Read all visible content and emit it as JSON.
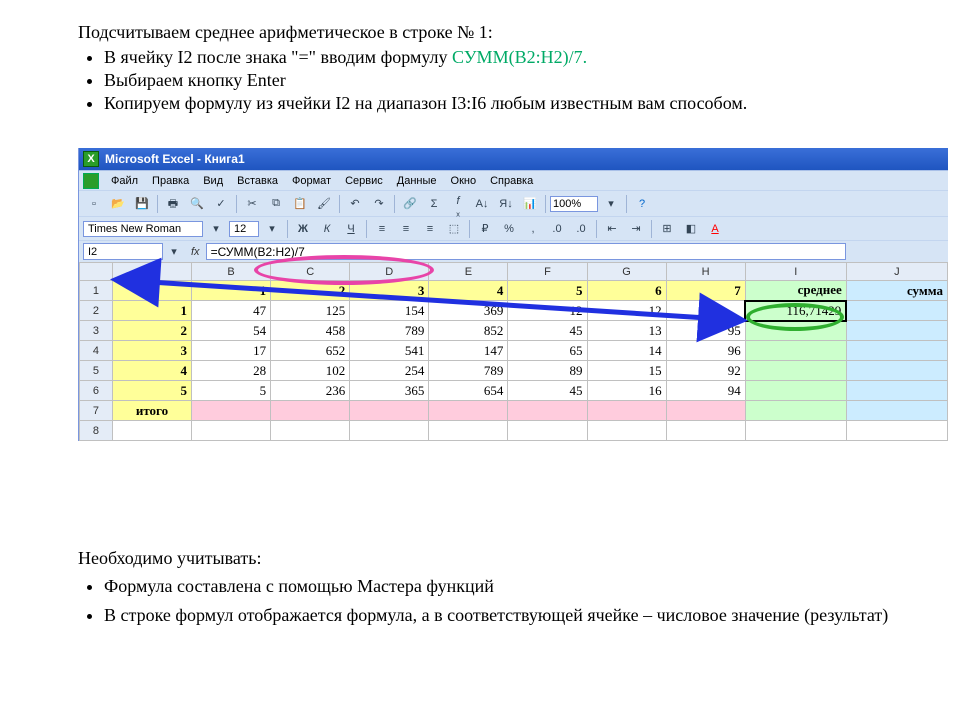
{
  "instructions": {
    "heading": "Подсчитываем среднее арифметическое в строке № 1:",
    "items": [
      {
        "prefix": "В ячейку I2 после знака \"=\" вводим формулу ",
        "formula": "СУММ(B2:H2)/7.",
        "suffix": ""
      },
      {
        "prefix": "Выбираем кнопку Enter",
        "formula": "",
        "suffix": ""
      },
      {
        "prefix": "Копируем формулу из ячейки I2 на диапазон I3:I6 любым известным вам способом.",
        "formula": "",
        "suffix": ""
      }
    ]
  },
  "notes": {
    "heading": "Необходимо учитывать:",
    "items": [
      "Формула составлена с помощью Мастера функций",
      "В строке формул отображается формула, а в соответствующей ячейке – числовое значение (результат)"
    ]
  },
  "excel": {
    "title": "Microsoft Excel - Книга1",
    "menus": [
      "Файл",
      "Правка",
      "Вид",
      "Вставка",
      "Формат",
      "Сервис",
      "Данные",
      "Окно",
      "Справка"
    ],
    "font": {
      "name": "Times New Roman",
      "size": "12"
    },
    "zoom": "100%",
    "namebox": "I2",
    "formula": "=СУММ(B2:H2)/7",
    "columns": [
      "A",
      "B",
      "C",
      "D",
      "E",
      "F",
      "G",
      "H",
      "I",
      "J"
    ],
    "headers": {
      "i": "среднее",
      "j": "сумма"
    },
    "rows": [
      {
        "n": "1",
        "label": "",
        "vals": [
          "1",
          "2",
          "3",
          "4",
          "5",
          "6",
          "7"
        ],
        "i": "среднее",
        "j": "сумма",
        "isHeader": true
      },
      {
        "n": "2",
        "label": "1",
        "vals": [
          "47",
          "125",
          "154",
          "369",
          "12",
          "12",
          ""
        ],
        "i": "116,71429",
        "j": ""
      },
      {
        "n": "3",
        "label": "2",
        "vals": [
          "54",
          "458",
          "789",
          "852",
          "45",
          "13",
          "95"
        ],
        "i": "",
        "j": ""
      },
      {
        "n": "4",
        "label": "3",
        "vals": [
          "17",
          "652",
          "541",
          "147",
          "65",
          "14",
          "96"
        ],
        "i": "",
        "j": ""
      },
      {
        "n": "5",
        "label": "4",
        "vals": [
          "28",
          "102",
          "254",
          "789",
          "89",
          "15",
          "92"
        ],
        "i": "",
        "j": ""
      },
      {
        "n": "6",
        "label": "5",
        "vals": [
          "5",
          "236",
          "365",
          "654",
          "45",
          "16",
          "94"
        ],
        "i": "",
        "j": ""
      },
      {
        "n": "7",
        "label": "итого",
        "vals": [
          "",
          "",
          "",
          "",
          "",
          "",
          ""
        ],
        "i": "",
        "j": "",
        "isTotal": true
      },
      {
        "n": "8",
        "label": "",
        "vals": [
          "",
          "",
          "",
          "",
          "",
          "",
          ""
        ],
        "i": "",
        "j": ""
      }
    ]
  }
}
